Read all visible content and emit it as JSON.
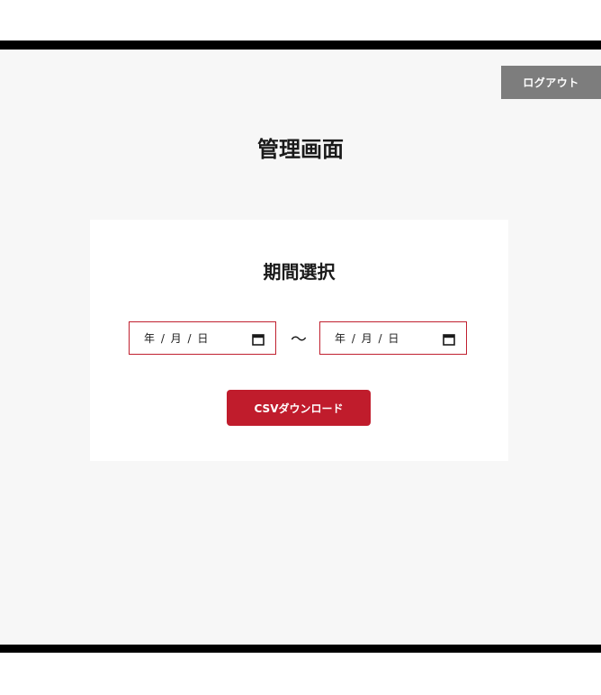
{
  "header": {
    "logout_label": "ログアウト"
  },
  "main": {
    "page_title": "管理画面",
    "card": {
      "title": "期間選択",
      "date_from": {
        "placeholder": "年 / 月 / 日",
        "value": ""
      },
      "separator": "～",
      "date_to": {
        "placeholder": "年 / 月 / 日",
        "value": ""
      },
      "download_label": "CSVダウンロード"
    }
  },
  "icons": {
    "calendar": "calendar-icon"
  },
  "colors": {
    "accent": "#c01c2c",
    "field_border": "#c0202f",
    "logout_bg": "#7d7d7d",
    "page_bg": "#f7f7f7",
    "card_bg": "#ffffff",
    "frame_bar": "#000000"
  }
}
